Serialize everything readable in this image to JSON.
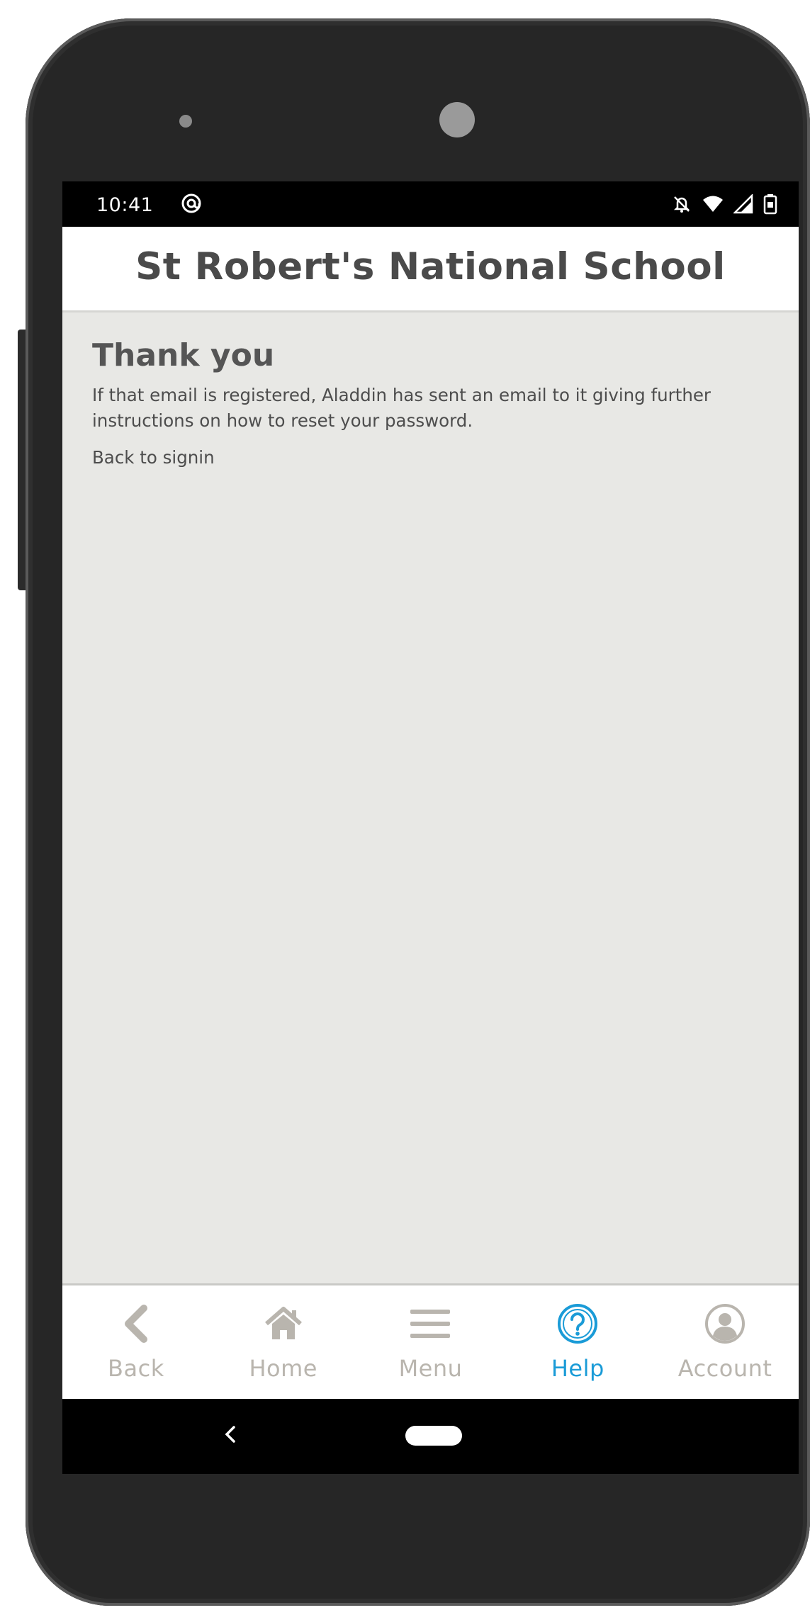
{
  "status_bar": {
    "time": "10:41",
    "left_icon": "at-sign-icon",
    "right_icons": [
      "notifications-off-icon",
      "wifi-icon",
      "signal-icon",
      "battery-icon"
    ]
  },
  "header": {
    "title": "St Robert's National School"
  },
  "main": {
    "heading": "Thank you",
    "message": "If that email is registered, Aladdin has sent an email to it giving further instructions on how to reset your password.",
    "back_link": "Back to signin"
  },
  "tab_bar": {
    "tabs": [
      {
        "label": "Back",
        "icon": "chevron-left-icon",
        "active": false
      },
      {
        "label": "Home",
        "icon": "home-icon",
        "active": false
      },
      {
        "label": "Menu",
        "icon": "hamburger-menu-icon",
        "active": false
      },
      {
        "label": "Help",
        "icon": "help-question-icon",
        "active": true
      },
      {
        "label": "Account",
        "icon": "account-user-icon",
        "active": false
      }
    ]
  },
  "colors": {
    "active_tab": "#1a9bd7",
    "inactive_tab": "#b9b5ae",
    "content_background": "#e8e8e5",
    "heading_text": "#555555"
  }
}
